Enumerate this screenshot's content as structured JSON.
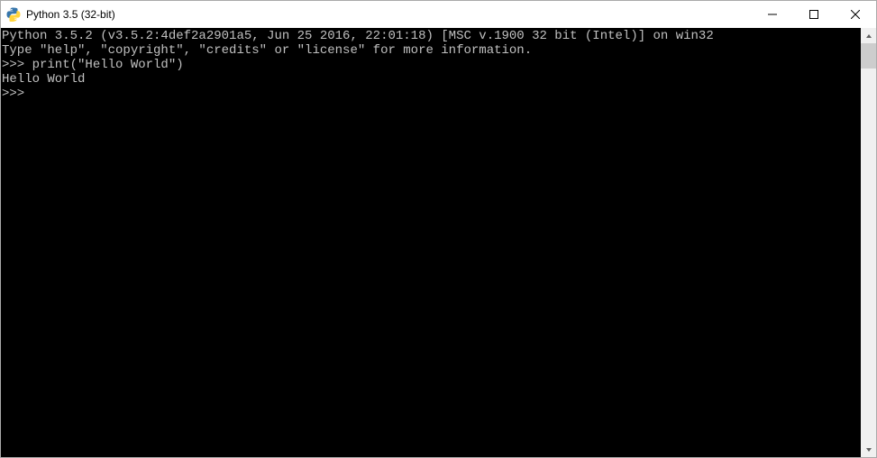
{
  "window": {
    "title": "Python 3.5 (32-bit)"
  },
  "console": {
    "lines": [
      "Python 3.5.2 (v3.5.2:4def2a2901a5, Jun 25 2016, 22:01:18) [MSC v.1900 32 bit (Intel)] on win32",
      "Type \"help\", \"copyright\", \"credits\" or \"license\" for more information.",
      ">>> print(\"Hello World\")",
      "Hello World",
      ">>>"
    ]
  }
}
